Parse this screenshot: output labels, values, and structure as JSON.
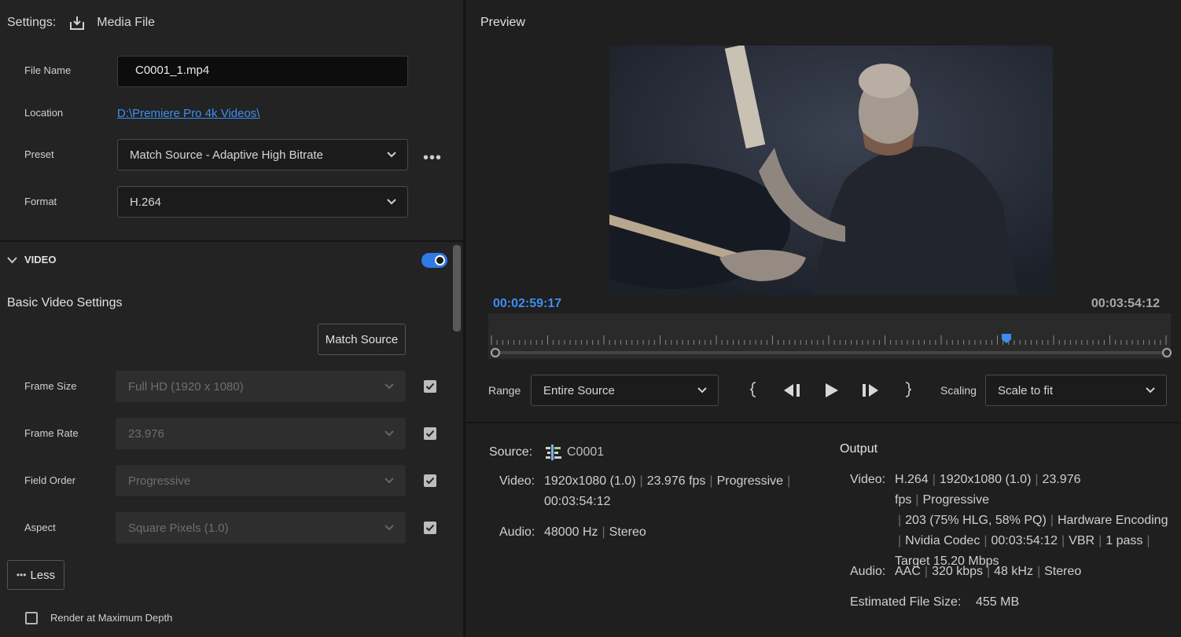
{
  "settings": {
    "label": "Settings:",
    "dest": "Media File",
    "file_name_label": "File Name",
    "file_name_value": "C0001_1.mp4",
    "location_label": "Location",
    "location_value": "D:\\Premiere Pro 4k Videos\\",
    "preset_label": "Preset",
    "preset_value": "Match Source - Adaptive High Bitrate",
    "format_label": "Format",
    "format_value": "H.264"
  },
  "video": {
    "header": "VIDEO",
    "enabled": true,
    "basic_title": "Basic Video Settings",
    "match_source": "Match Source",
    "rows": [
      {
        "label": "Frame Size",
        "value": "Full HD (1920 x 1080)",
        "checked": true
      },
      {
        "label": "Frame Rate",
        "value": "23.976",
        "checked": true
      },
      {
        "label": "Field Order",
        "value": "Progressive",
        "checked": true
      },
      {
        "label": "Aspect",
        "value": "Square Pixels (1.0)",
        "checked": true
      }
    ],
    "less_button": "Less",
    "render_max_depth": "Render at Maximum Depth"
  },
  "preview": {
    "title": "Preview",
    "current_tc": "00:02:59:17",
    "end_tc": "00:03:54:12",
    "playhead_fraction": 0.76,
    "range_label": "Range",
    "range_value": "Entire Source",
    "scaling_label": "Scaling",
    "scaling_value": "Scale to fit"
  },
  "source": {
    "label": "Source:",
    "name": "C0001",
    "video_label": "Video:",
    "video_line1": [
      "1920x1080 (1.0)",
      "23.976 fps",
      "Progressive",
      ""
    ],
    "video_line2": "00:03:54:12",
    "audio_label": "Audio:",
    "audio_values": [
      "48000 Hz",
      "Stereo"
    ]
  },
  "output": {
    "title": "Output",
    "video_label": "Video:",
    "video_line1": [
      "H.264",
      "1920x1080 (1.0)",
      "23.976 fps",
      "Progressive"
    ],
    "video_line2": [
      "203 (75% HLG, 58% PQ)",
      "Hardware Encoding"
    ],
    "video_line3": [
      "Nvidia Codec",
      "00:03:54:12",
      "VBR",
      "1 pass",
      ""
    ],
    "video_line4": "Target 15.20 Mbps",
    "audio_label": "Audio:",
    "audio_values": [
      "AAC",
      "320 kbps",
      "48 kHz",
      "Stereo"
    ],
    "size_label": "Estimated File Size:",
    "size_value": "455 MB"
  },
  "icons": {
    "export": "export-icon",
    "chevron": "chevron-down-icon",
    "more": "more-icon",
    "sequence": "sequence-icon"
  },
  "colors": {
    "accent": "#3e8ef1",
    "toggle": "#2f7ae5"
  }
}
